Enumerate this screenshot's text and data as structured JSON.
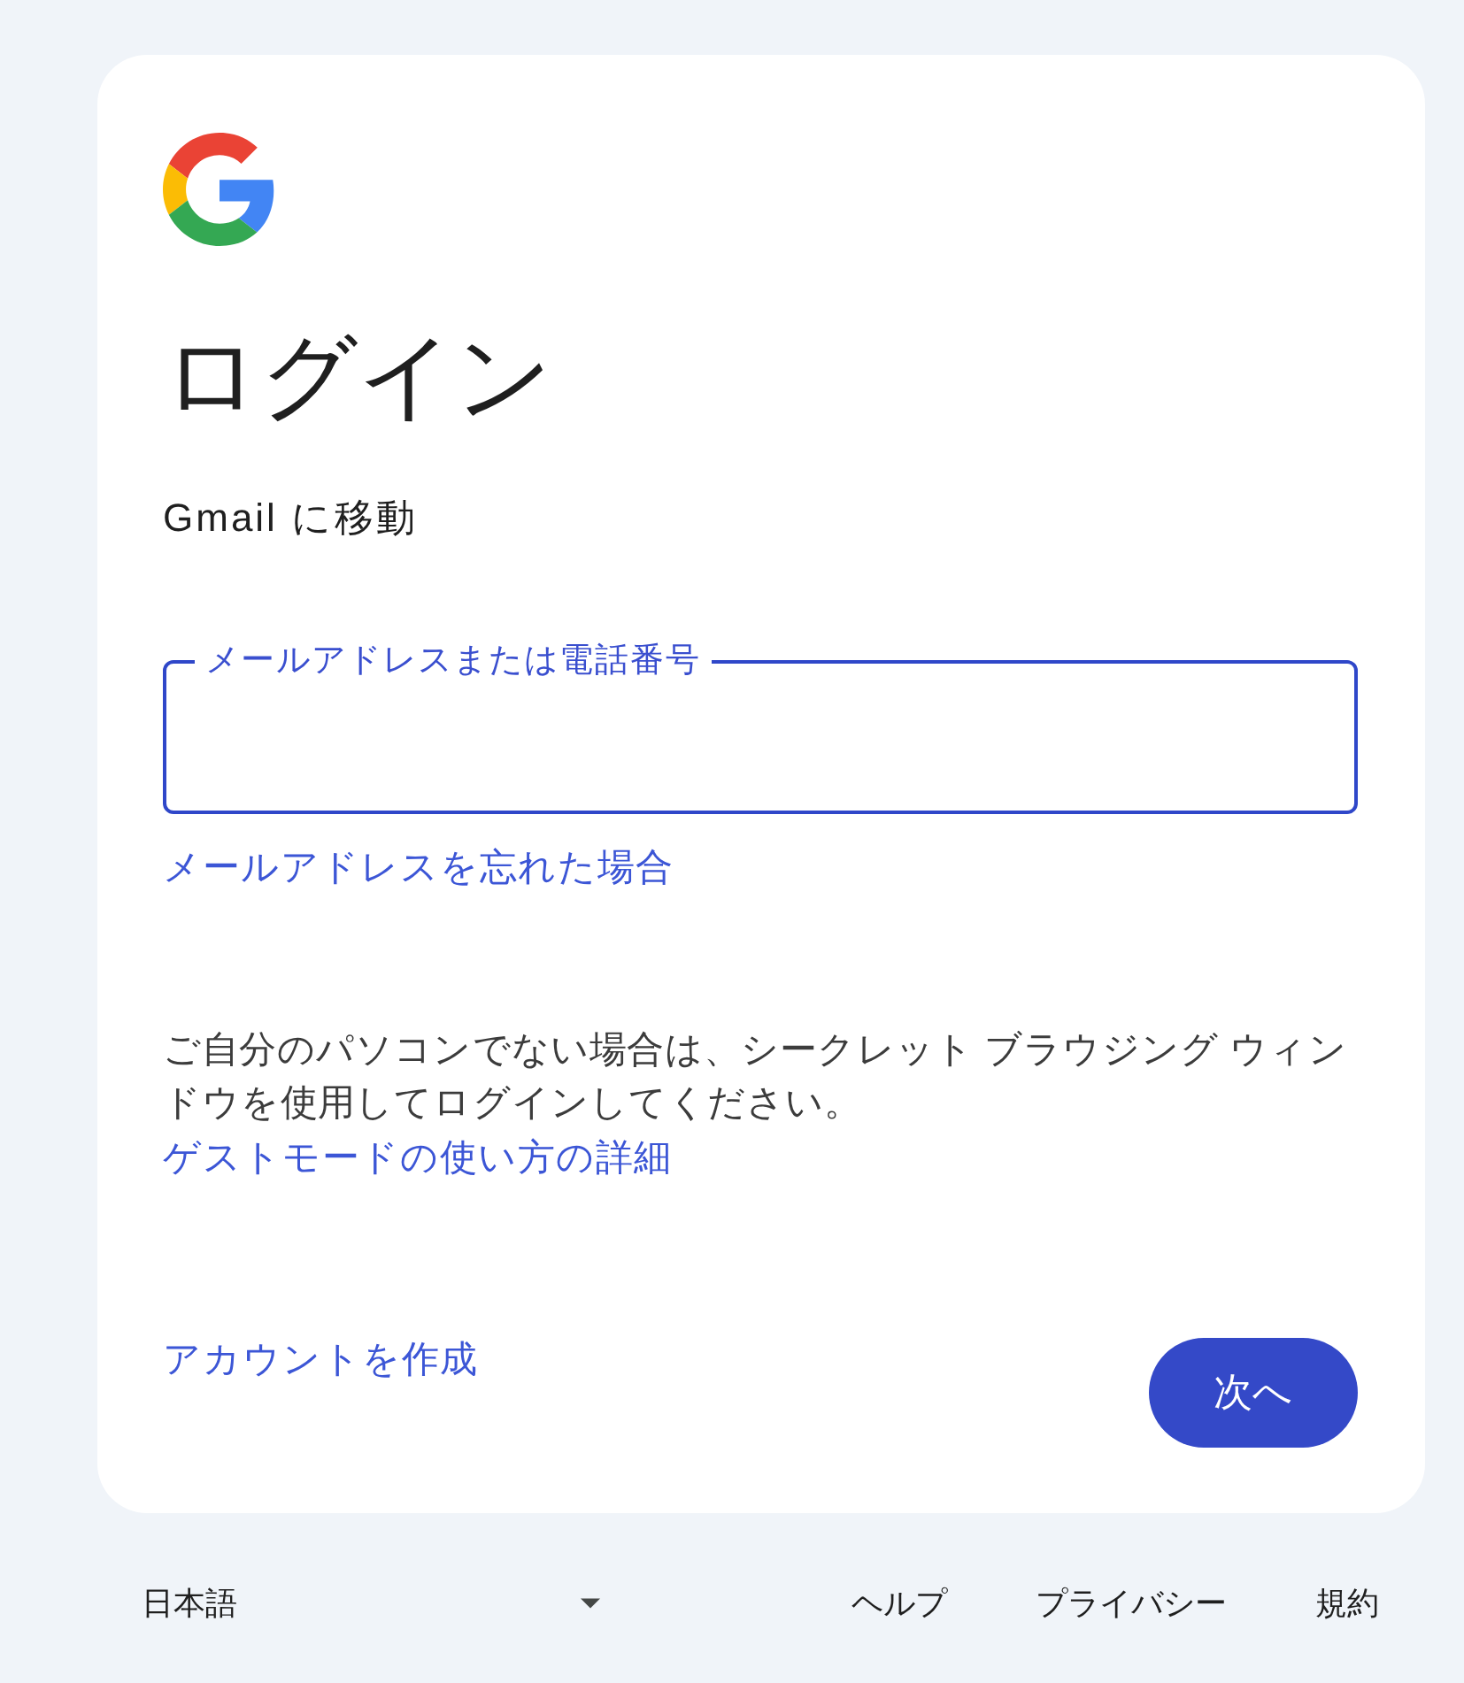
{
  "heading": "ログイン",
  "subheading": "Gmail に移動",
  "email_field": {
    "label": "メールアドレスまたは電話番号",
    "focused": true
  },
  "forgot_link": "メールアドレスを忘れた場合",
  "guest_notice": {
    "text": "ご自分のパソコンでない場合は、シークレット ブラウジング ウィンドウを使用してログインしてください。",
    "link": "ゲストモードの使い方の詳細"
  },
  "create_account_link": "アカウントを作成",
  "next_button": "次へ",
  "footer": {
    "language": "日本語",
    "links": [
      "ヘルプ",
      "プライバシー",
      "規約"
    ]
  }
}
